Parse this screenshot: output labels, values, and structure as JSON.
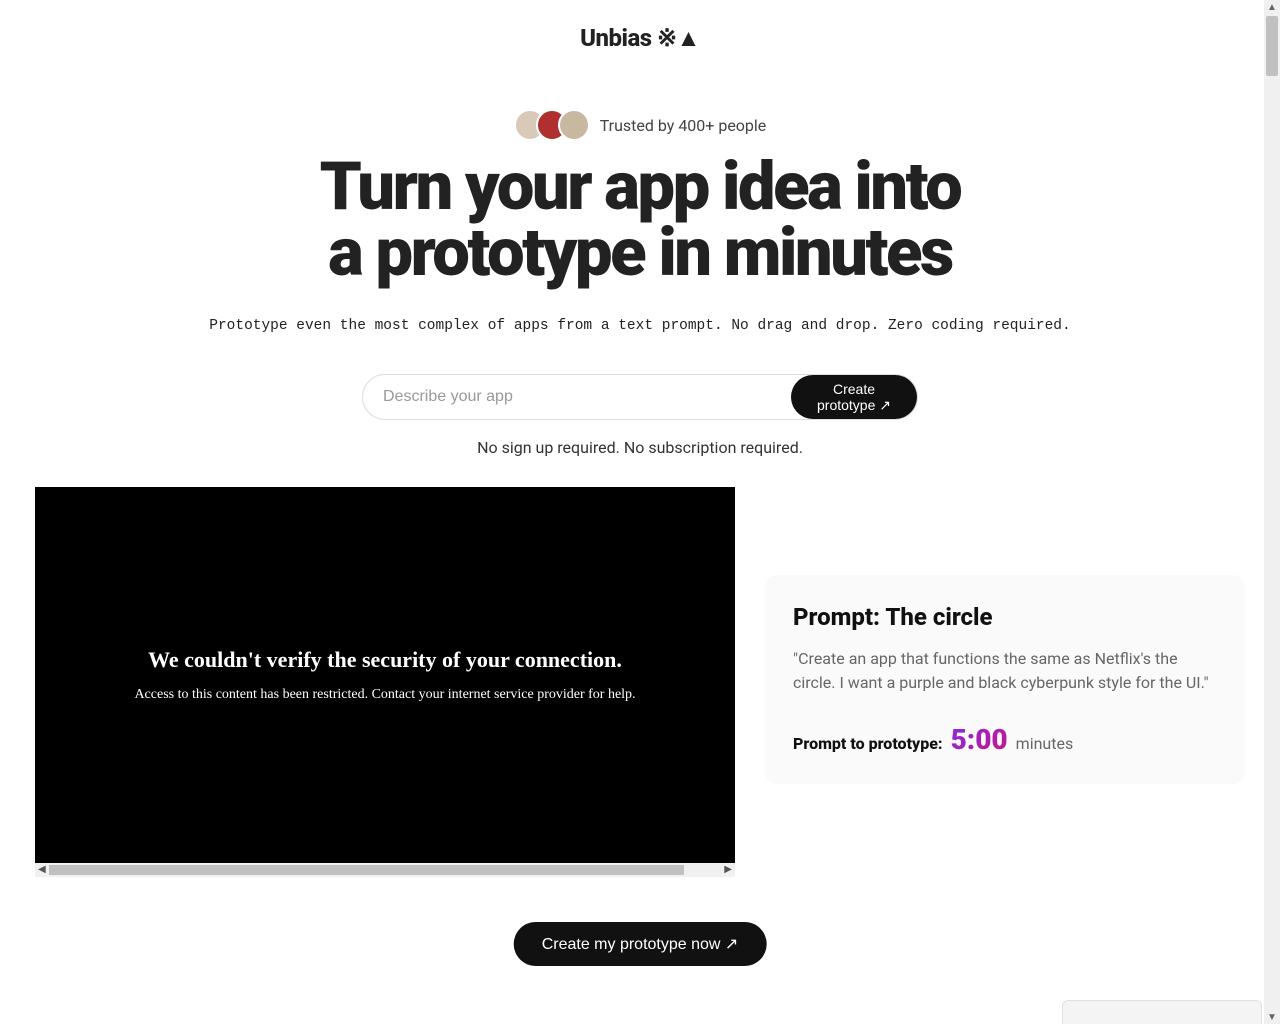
{
  "logo": "Unbias ※▲",
  "trust": {
    "text": "Trusted by 400+ people"
  },
  "hero": {
    "title_line1": "Turn your app idea into",
    "title_line2": "a prototype in minutes",
    "subtitle": "Prototype even the most complex of apps from a text prompt. No drag and drop. Zero coding required."
  },
  "form": {
    "placeholder": "Describe your app",
    "button_line1": "Create",
    "button_line2": "prototype ↗"
  },
  "no_signup": "No sign up required. No subscription required.",
  "video_error": {
    "title": "We couldn't verify the security of your connection.",
    "body": "Access to this content has been restricted. Contact your internet service provider for help."
  },
  "prompt_card": {
    "heading": "Prompt: The circle",
    "quote": "\"Create an app that functions the same as Netflix's the circle. I want a purple and black cyberpunk style for the UI.\"",
    "ptp_label": "Prompt to prototype:",
    "ptp_time": "5:00",
    "ptp_unit": "minutes"
  },
  "bottom_cta": "Create my prototype now ↗"
}
